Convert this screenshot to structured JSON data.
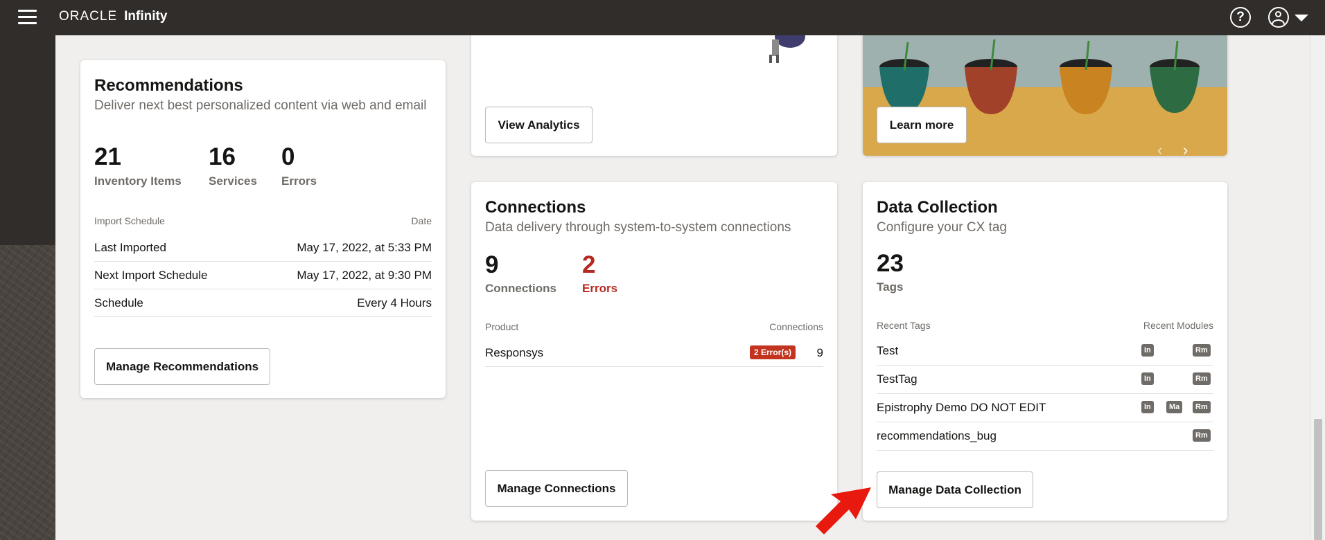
{
  "header": {
    "brand_oracle": "ORACLE",
    "brand_product": "Infinity",
    "help_glyph": "?"
  },
  "recommendations": {
    "title": "Recommendations",
    "subtitle": "Deliver next best personalized content via web and email",
    "stats": [
      {
        "value": "21",
        "label": "Inventory Items"
      },
      {
        "value": "16",
        "label": "Services"
      },
      {
        "value": "0",
        "label": "Errors"
      }
    ],
    "table_header_left": "Import Schedule",
    "table_header_right": "Date",
    "rows": [
      {
        "label": "Last Imported",
        "value": "May 17, 2022, at 5:33 PM"
      },
      {
        "label": "Next Import Schedule",
        "value": "May 17, 2022, at 9:30 PM"
      },
      {
        "label": "Schedule",
        "value": "Every 4 Hours"
      }
    ],
    "button": "Manage Recommendations"
  },
  "analytics": {
    "button": "View Analytics"
  },
  "promo": {
    "button": "Learn more",
    "prev": "‹",
    "next": "›"
  },
  "connections": {
    "title": "Connections",
    "subtitle": "Data delivery through system-to-system connections",
    "stats": [
      {
        "value": "9",
        "label": "Connections"
      },
      {
        "value": "2",
        "label": "Errors"
      }
    ],
    "table_header_left": "Product",
    "table_header_right": "Connections",
    "rows": [
      {
        "product": "Responsys",
        "error_badge": "2 Error(s)",
        "count": "9"
      }
    ],
    "button": "Manage Connections"
  },
  "data_collection": {
    "title": "Data Collection",
    "subtitle": "Configure your CX tag",
    "stat": {
      "value": "23",
      "label": "Tags"
    },
    "table_header_left": "Recent Tags",
    "table_header_right": "Recent Modules",
    "rows": [
      {
        "tag": "Test",
        "modules": [
          "In",
          "Rm"
        ]
      },
      {
        "tag": "TestTag",
        "modules": [
          "In",
          "Rm"
        ]
      },
      {
        "tag": "Epistrophy Demo DO NOT EDIT",
        "modules": [
          "In",
          "Ma",
          "Rm"
        ]
      },
      {
        "tag": "recommendations_bug",
        "modules": [
          "Rm"
        ]
      }
    ],
    "button": "Manage Data Collection"
  },
  "colors": {
    "accent_error": "#c2341f",
    "topbar": "#312d2a",
    "promo_bg": "#d9a84a",
    "pointer": "#e8190f"
  }
}
